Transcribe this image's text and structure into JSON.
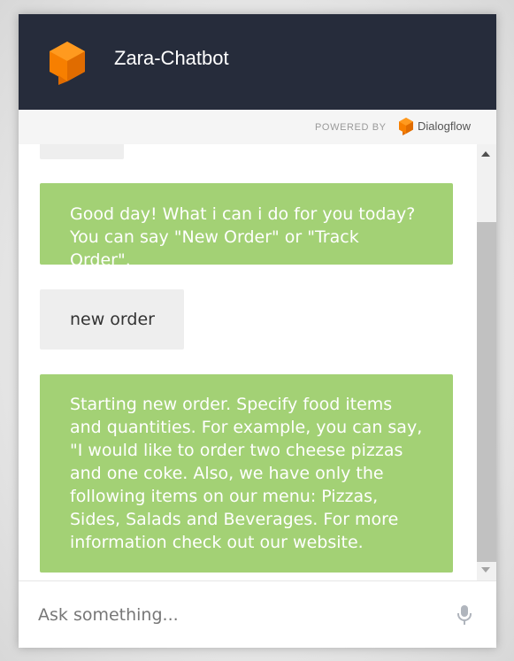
{
  "header": {
    "title": "Zara-Chatbot",
    "logo_icon": "dialogflow-cube-icon",
    "background_color": "#262c3b",
    "logo_color": "#f77f00"
  },
  "powered_bar": {
    "label": "POWERED BY",
    "brand_name": "Dialogflow",
    "brand_icon": "dialogflow-icon"
  },
  "messages": [
    {
      "sender": "user",
      "text": ""
    },
    {
      "sender": "bot",
      "text": "Good day! What i can i do for you today? You can say \"New Order\" or \"Track Order\"."
    },
    {
      "sender": "user",
      "text": "new order"
    },
    {
      "sender": "bot",
      "text": "Starting new order. Specify food items and quantities. For example, you can say, \"I would like to order two cheese pizzas and one coke. Also, we have only the following items on our menu: Pizzas, Sides, Salads and Beverages. For more information check out our website."
    }
  ],
  "colors": {
    "bot_bubble": "#a3d175",
    "user_bubble": "#eeeeee"
  },
  "input": {
    "placeholder": "Ask something...",
    "value": "",
    "mic_icon": "microphone-icon"
  }
}
